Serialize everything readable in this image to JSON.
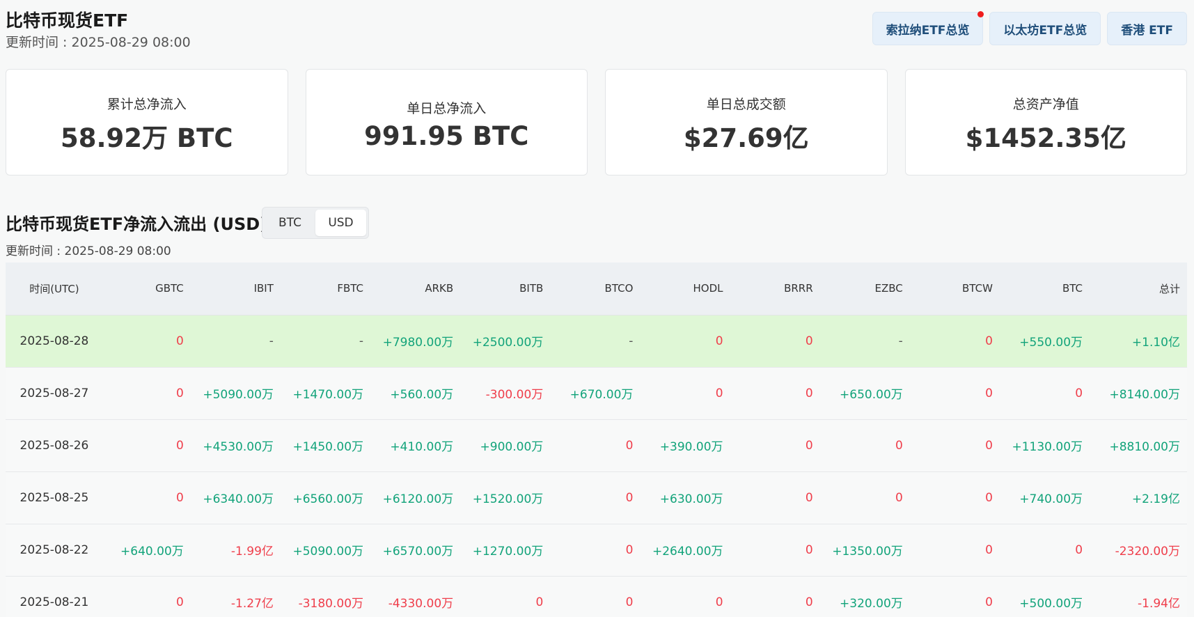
{
  "header": {
    "title": "比特币现货ETF",
    "updated": "更新时间 : 2025-08-29 08:00",
    "buttons": [
      {
        "label": "索拉纳ETF总览",
        "badge": true
      },
      {
        "label": "以太坊ETF总览",
        "badge": false
      },
      {
        "label": "香港 ETF",
        "badge": false
      }
    ]
  },
  "cards": [
    {
      "label": "累计总净流入",
      "value": "58.92万 BTC"
    },
    {
      "label": "单日总净流入",
      "value": "991.95 BTC"
    },
    {
      "label": "单日总成交额",
      "value": "$27.69亿"
    },
    {
      "label": "总资产净值",
      "value": "$1452.35亿"
    }
  ],
  "section": {
    "title": "比特币现货ETF净流入流出 (USD)",
    "updated": "更新时间 : 2025-08-29 08:00",
    "toggle": {
      "options": [
        "BTC",
        "USD"
      ],
      "selected": "USD"
    }
  },
  "colors": {
    "positive": "#12a37a",
    "negative": "#ef3e4b",
    "highlight_row": "#dff7d6",
    "button_text": "#1f4e7a",
    "badge": "#f01c1c"
  },
  "table": {
    "columns": [
      "时间(UTC)",
      "GBTC",
      "IBIT",
      "FBTC",
      "ARKB",
      "BITB",
      "BTCO",
      "HODL",
      "BRRR",
      "EZBC",
      "BTCW",
      "BTC",
      "总计"
    ],
    "rows": [
      {
        "highlight": true,
        "cells": [
          "2025-08-28",
          "0",
          "-",
          "-",
          "+7980.00万",
          "+2500.00万",
          "-",
          "0",
          "0",
          "-",
          "0",
          "+550.00万",
          "+1.10亿"
        ]
      },
      {
        "highlight": false,
        "cells": [
          "2025-08-27",
          "0",
          "+5090.00万",
          "+1470.00万",
          "+560.00万",
          "-300.00万",
          "+670.00万",
          "0",
          "0",
          "+650.00万",
          "0",
          "0",
          "+8140.00万"
        ]
      },
      {
        "highlight": false,
        "cells": [
          "2025-08-26",
          "0",
          "+4530.00万",
          "+1450.00万",
          "+410.00万",
          "+900.00万",
          "0",
          "+390.00万",
          "0",
          "0",
          "0",
          "+1130.00万",
          "+8810.00万"
        ]
      },
      {
        "highlight": false,
        "cells": [
          "2025-08-25",
          "0",
          "+6340.00万",
          "+6560.00万",
          "+6120.00万",
          "+1520.00万",
          "0",
          "+630.00万",
          "0",
          "0",
          "0",
          "+740.00万",
          "+2.19亿"
        ]
      },
      {
        "highlight": false,
        "cells": [
          "2025-08-22",
          "+640.00万",
          "-1.99亿",
          "+5090.00万",
          "+6570.00万",
          "+1270.00万",
          "0",
          "+2640.00万",
          "0",
          "+1350.00万",
          "0",
          "0",
          "-2320.00万"
        ]
      },
      {
        "highlight": false,
        "cells": [
          "2025-08-21",
          "0",
          "-1.27亿",
          "-3180.00万",
          "-4330.00万",
          "0",
          "0",
          "0",
          "0",
          "+320.00万",
          "0",
          "+500.00万",
          "-1.94亿"
        ]
      }
    ]
  }
}
